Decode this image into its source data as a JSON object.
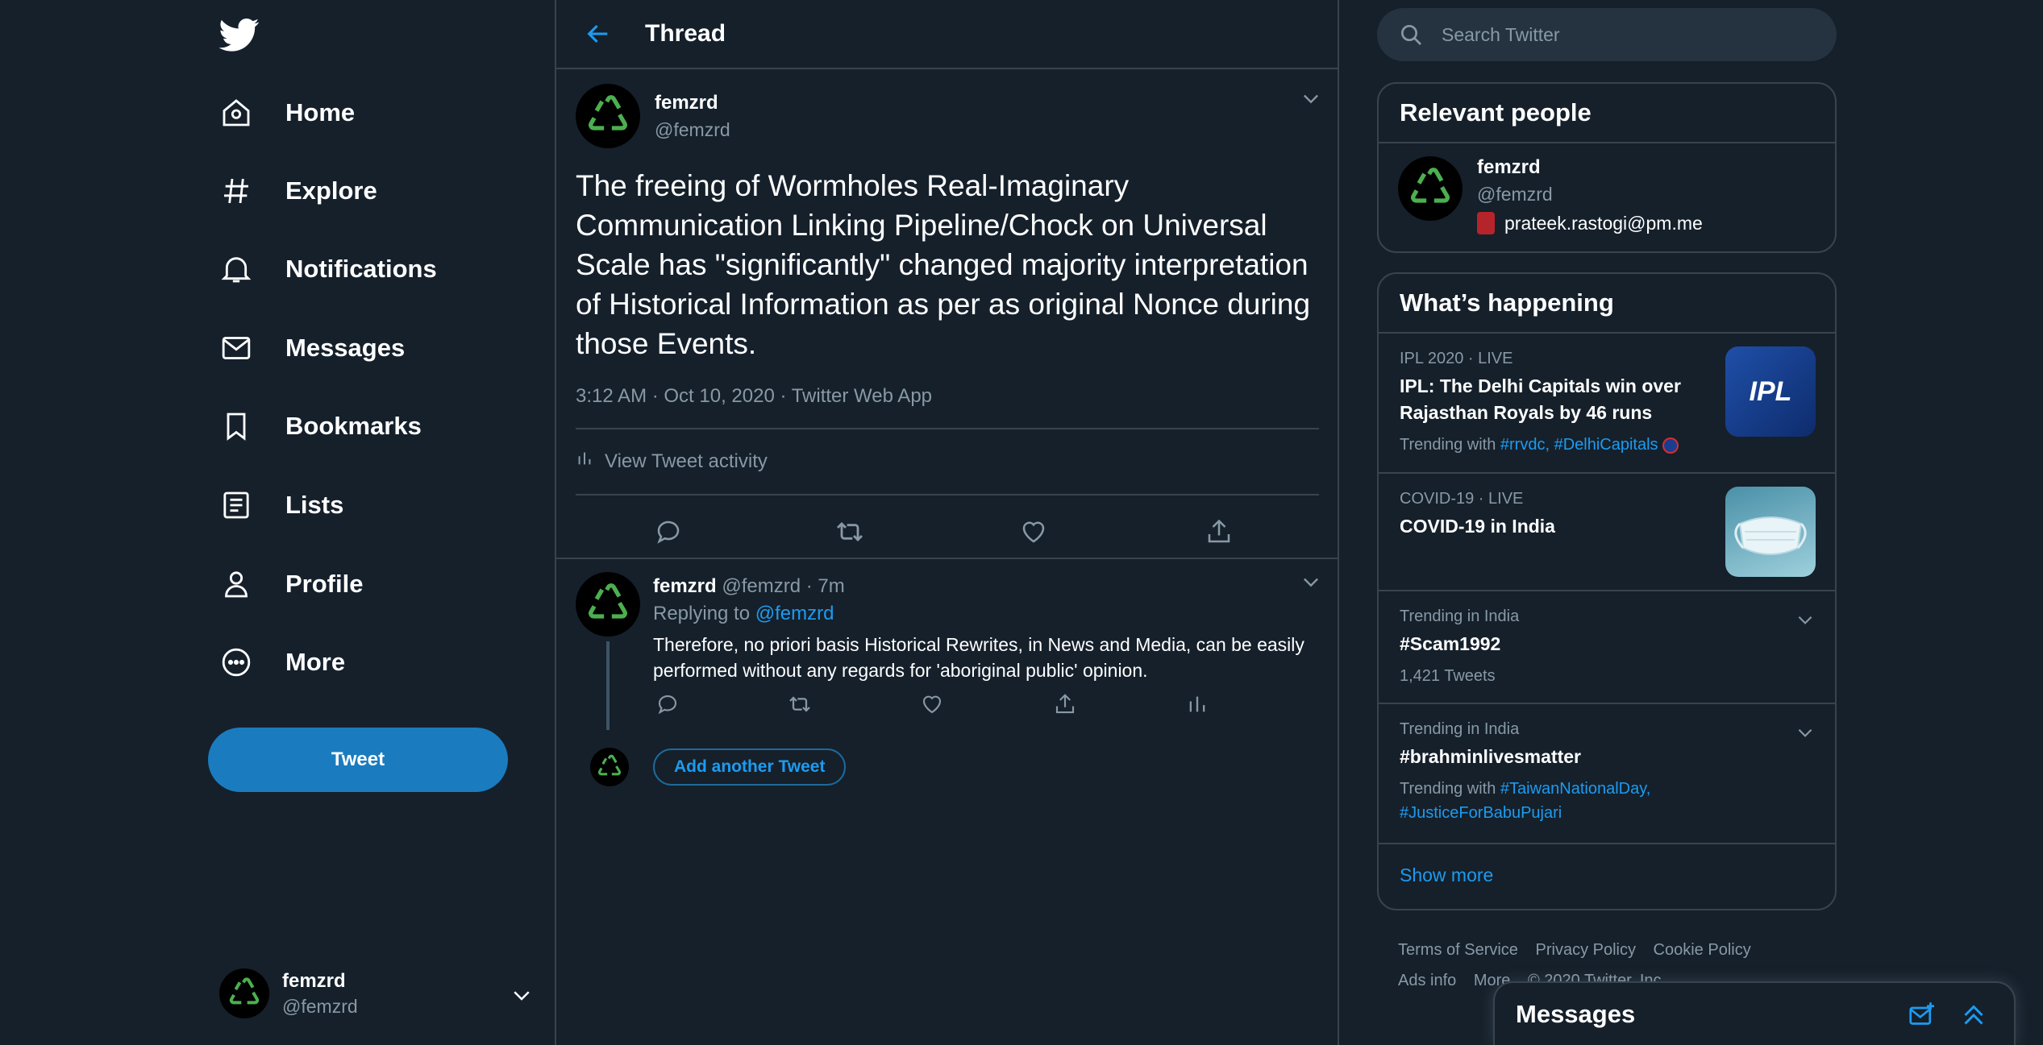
{
  "sidebar": {
    "nav": [
      {
        "label": "Home",
        "icon": "home-icon"
      },
      {
        "label": "Explore",
        "icon": "hashtag-icon"
      },
      {
        "label": "Notifications",
        "icon": "bell-icon"
      },
      {
        "label": "Messages",
        "icon": "envelope-icon"
      },
      {
        "label": "Bookmarks",
        "icon": "bookmark-icon"
      },
      {
        "label": "Lists",
        "icon": "list-icon"
      },
      {
        "label": "Profile",
        "icon": "person-icon"
      },
      {
        "label": "More",
        "icon": "more-circle-icon"
      }
    ],
    "tweet_button": "Tweet",
    "account": {
      "display_name": "femzrd",
      "handle": "@femzrd"
    }
  },
  "main": {
    "title": "Thread",
    "tweet": {
      "display_name": "femzrd",
      "handle": "@femzrd",
      "text": "The freeing of Wormholes Real-Imaginary Communication Linking Pipeline/Chock on Universal Scale has \"significantly\" changed majority interpretation of Historical Information as per as original Nonce during those Events.",
      "meta": "3:12 AM · Oct 10, 2020 · Twitter Web App",
      "activity_label": "View Tweet activity"
    },
    "reply": {
      "display_name": "femzrd",
      "meta": "@femzrd · 7m",
      "replying_prefix": "Replying to",
      "replying_to": "@femzrd",
      "text": "Therefore, no priori basis Historical Rewrites, in News and Media, can be easily performed without any regards for 'aboriginal public' opinion."
    },
    "add_another": "Add another Tweet"
  },
  "right": {
    "search_placeholder": "Search Twitter",
    "relevant": {
      "title": "Relevant people",
      "person": {
        "display_name": "femzrd",
        "handle": "@femzrd",
        "bio": "prateek.rastogi@pm.me"
      }
    },
    "happening": {
      "title": "What’s happening",
      "trends": [
        {
          "context": "IPL 2020 · LIVE",
          "title": "IPL: The Delhi Capitals win over Rajasthan Royals by 46 runs",
          "sub_prefix": "Trending with",
          "sub_links": "#rrvdc, #DelhiCapitals"
        },
        {
          "context": "COVID-19 · LIVE",
          "title": "COVID-19 in India"
        },
        {
          "context": "Trending in India",
          "title": "#Scam1992",
          "sub": "1,421 Tweets"
        },
        {
          "context": "Trending in India",
          "title": "#brahminlivesmatter",
          "sub_prefix": "Trending with",
          "sub_link1": "#TaiwanNationalDay,",
          "sub_link2": "#JusticeForBabuPujari"
        }
      ],
      "ipl_logo_text": "IPL",
      "show_more": "Show more"
    },
    "footer": {
      "terms": "Terms of Service",
      "privacy": "Privacy Policy",
      "cookie": "Cookie Policy",
      "ads": "Ads info",
      "more": "More",
      "copyright": "© 2020 Twitter, Inc."
    }
  },
  "messages_drawer": {
    "title": "Messages"
  },
  "colors": {
    "background": "#15202b",
    "border": "#38444d",
    "accent": "#1d9bf0",
    "tweet_button": "#1a7cbf",
    "muted_text": "#8899a6",
    "avatar_recycle": "#4caf50"
  }
}
